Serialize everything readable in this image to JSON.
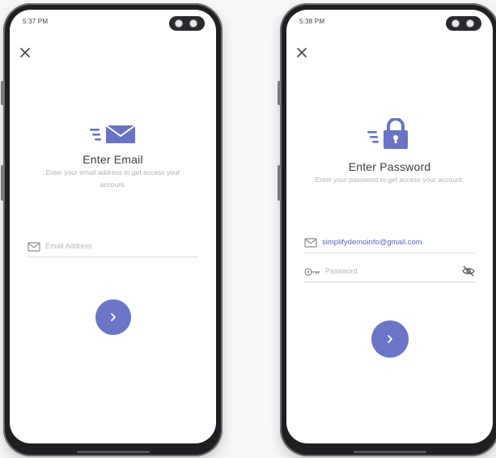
{
  "left_screen": {
    "status_time": "5:37 PM",
    "title": "Enter Email",
    "subtitle": "Enter your email address to get access your account.",
    "email_placeholder": "Email Address",
    "icons": {
      "close": "close-icon",
      "hero": "mail-icon",
      "field": "envelope-icon",
      "submit": "chevron-right-icon"
    }
  },
  "right_screen": {
    "status_time": "5:38 PM",
    "title": "Enter Password",
    "subtitle": "Enter your password to get access your account.",
    "email_value": "simplifydemoinfo@gmail.com",
    "password_placeholder": "Password",
    "icons": {
      "close": "close-icon",
      "hero": "lock-icon",
      "email_field": "envelope-icon",
      "password_field": "key-icon",
      "visibility": "eye-off-icon",
      "submit": "chevron-right-icon"
    }
  },
  "colors": {
    "accent": "#6b76c6",
    "title": "#3b3b42",
    "muted": "#b0b0b6"
  }
}
